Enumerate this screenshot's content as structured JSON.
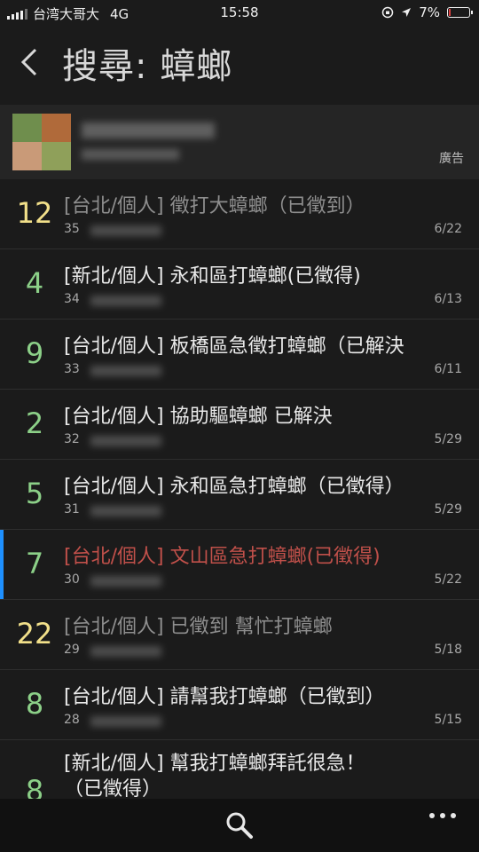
{
  "status_bar": {
    "carrier": "台湾大哥大",
    "network": "4G",
    "time": "15:58",
    "battery": "7%",
    "battery_level": 0.07
  },
  "header": {
    "title": "搜尋: 蟑螂"
  },
  "ad": {
    "label": "廣告"
  },
  "posts": [
    {
      "num": "12",
      "num_color": "yellow",
      "title": "[台北/個人] 徵打大蟑螂（已徵到）",
      "title_style": "gray",
      "meta": "35",
      "date": "6/22"
    },
    {
      "num": "4",
      "num_color": "green",
      "title": "[新北/個人] 永和區打蟑螂(已徵得)",
      "title_style": "white",
      "meta": "34",
      "date": "6/13"
    },
    {
      "num": "9",
      "num_color": "green",
      "title": "[台北/個人] 板橋區急徵打蟑螂（已解決",
      "title_style": "white",
      "meta": "33",
      "date": "6/11"
    },
    {
      "num": "2",
      "num_color": "green",
      "title": "[台北/個人] 協助驅蟑螂 已解決",
      "title_style": "white",
      "meta": "32",
      "date": "5/29"
    },
    {
      "num": "5",
      "num_color": "green",
      "title": "[台北/個人] 永和區急打蟑螂（已徵得）",
      "title_style": "white",
      "meta": "31",
      "date": "5/29"
    },
    {
      "num": "7",
      "num_color": "green",
      "title": "[台北/個人] 文山區急打蟑螂(已徵得)",
      "title_style": "red",
      "meta": "30",
      "date": "5/22"
    },
    {
      "num": "22",
      "num_color": "yellow",
      "title": "[台北/個人] 已徵到 幫忙打蟑螂",
      "title_style": "gray",
      "meta": "29",
      "date": "5/18"
    },
    {
      "num": "8",
      "num_color": "green",
      "title": "[台北/個人] 請幫我打蟑螂（已徵到）",
      "title_style": "white",
      "meta": "28",
      "date": "5/15"
    },
    {
      "num": "8",
      "num_color": "green",
      "title_line1": "[新北/個人] 幫我打蟑螂拜託很急！",
      "title_line2": "（已徵得）",
      "title_style": "white"
    }
  ],
  "icons": {
    "back": "chevron-left-icon",
    "search": "search-icon",
    "more": "more-dots-icon"
  },
  "colors": {
    "background": "#1b1b1b",
    "number_green": "#8cd088",
    "number_yellow": "#f2e08a",
    "title_red": "#c0504a",
    "selected_bar": "#1e90ff"
  }
}
